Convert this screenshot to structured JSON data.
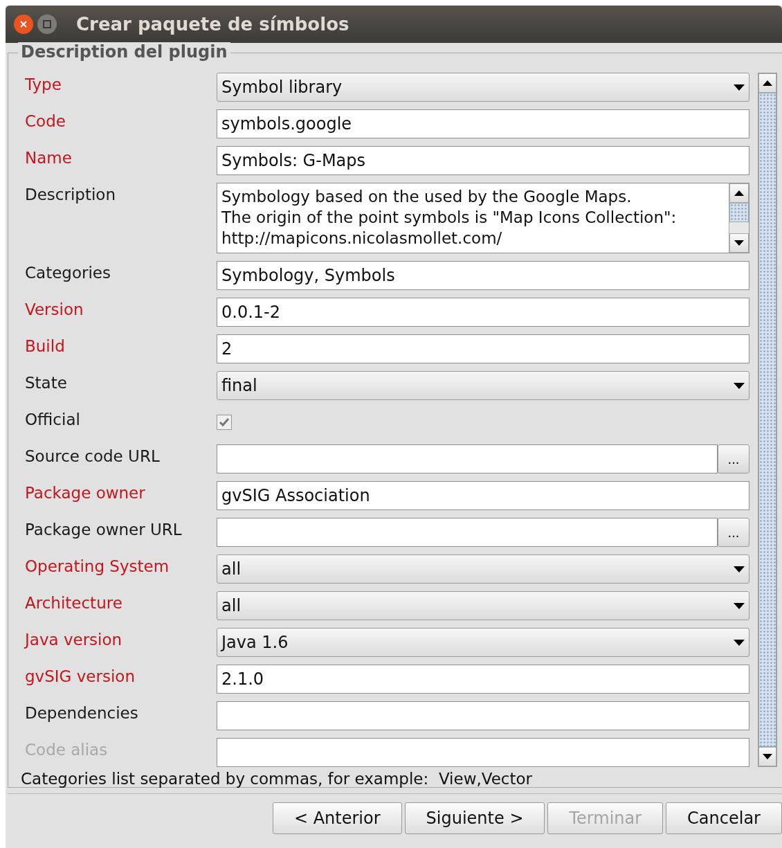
{
  "window": {
    "title": "Crear paquete de símbolos"
  },
  "panel": {
    "title": "Description del plugin"
  },
  "fields": [
    {
      "label": "Type",
      "kind": "combo",
      "required": true,
      "disabled": false,
      "value": "Symbol library"
    },
    {
      "label": "Code",
      "kind": "text",
      "required": true,
      "disabled": false,
      "value": "symbols.google"
    },
    {
      "label": "Name",
      "kind": "text",
      "required": true,
      "disabled": false,
      "value": "Symbols: G-Maps"
    },
    {
      "label": "Description",
      "kind": "textarea",
      "required": false,
      "disabled": false,
      "lines": [
        "Symbology based on the used by the Google Maps.",
        "The origin of the point symbols is \"Map Icons Collection\":",
        "http://mapicons.nicolasmollet.com/"
      ]
    },
    {
      "label": "Categories",
      "kind": "text",
      "required": false,
      "disabled": false,
      "value": "Symbology, Symbols"
    },
    {
      "label": "Version",
      "kind": "text",
      "required": true,
      "disabled": false,
      "value": "0.0.1-2"
    },
    {
      "label": "Build",
      "kind": "text",
      "required": true,
      "disabled": false,
      "value": "2"
    },
    {
      "label": "State",
      "kind": "combo",
      "required": false,
      "disabled": false,
      "value": "final"
    },
    {
      "label": "Official",
      "kind": "checkbox",
      "required": false,
      "disabled": false,
      "checked": true
    },
    {
      "label": "Source code URL",
      "kind": "browse",
      "required": false,
      "disabled": false,
      "button": "..."
    },
    {
      "label": "Package owner",
      "kind": "text",
      "required": true,
      "disabled": false,
      "value": "gvSIG Association"
    },
    {
      "label": "Package owner URL",
      "kind": "browse",
      "required": false,
      "disabled": false,
      "button": "..."
    },
    {
      "label": "Operating System",
      "kind": "combo",
      "required": true,
      "disabled": false,
      "value": "all"
    },
    {
      "label": "Architecture",
      "kind": "combo",
      "required": true,
      "disabled": false,
      "value": "all"
    },
    {
      "label": "Java version",
      "kind": "combo",
      "required": true,
      "disabled": false,
      "value": "Java 1.6"
    },
    {
      "label": "gvSIG version",
      "kind": "text",
      "required": true,
      "disabled": false,
      "value": "2.1.0"
    },
    {
      "label": "Dependencies",
      "kind": "text",
      "required": false,
      "disabled": false
    },
    {
      "label": "Code alias",
      "kind": "text",
      "required": false,
      "disabled": true
    }
  ],
  "hint": "Categories list separated by commas, for example:  View,Vector",
  "buttons": [
    {
      "label": "< Anterior",
      "disabled": false
    },
    {
      "label": "Siguiente >",
      "disabled": false
    },
    {
      "label": "Terminar",
      "disabled": true
    },
    {
      "label": "Cancelar",
      "disabled": false
    }
  ]
}
